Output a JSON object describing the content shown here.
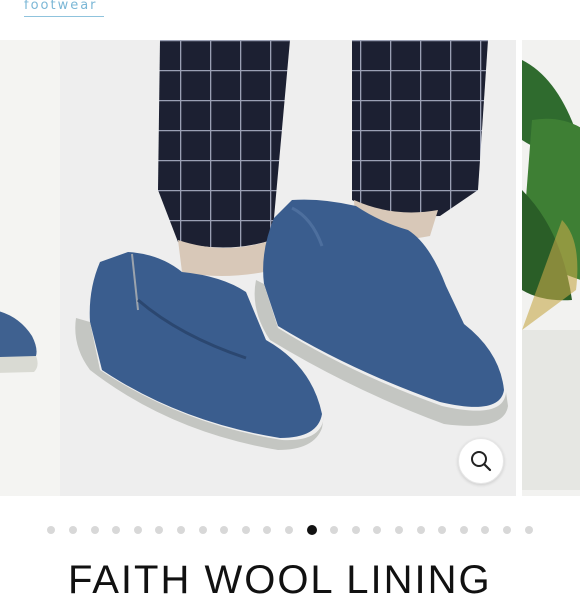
{
  "brand": {
    "text": "footwear"
  },
  "gallery": {
    "zoom_icon": "magnifier-icon",
    "slide_count": 23,
    "active_index": 12
  },
  "product": {
    "title": "FAITH WOOL LINING"
  },
  "colors": {
    "shoe": "#3a5d8e",
    "sole": "#c4c6c2",
    "trousers": "#1c2032",
    "dot_inactive": "#d8d8d8",
    "dot_active": "#111111",
    "brand": "#7bb7d6"
  }
}
